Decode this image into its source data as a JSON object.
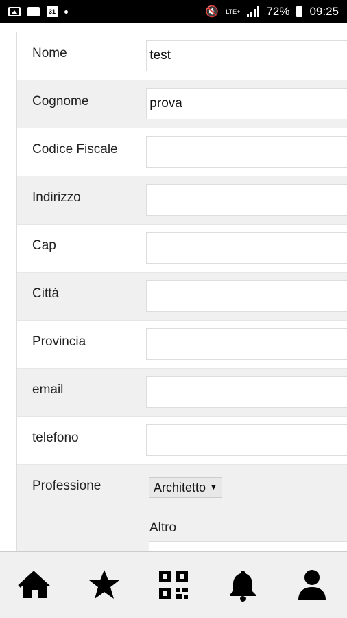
{
  "status_bar": {
    "calendar_day": "31",
    "network": "LTE+",
    "battery": "72%",
    "time": "09:25",
    "icons": [
      "picture-icon",
      "message-icon",
      "calendar-icon",
      "dot-icon",
      "mute-icon",
      "lte-icon",
      "signal-icon",
      "battery-icon"
    ]
  },
  "form": {
    "fields": [
      {
        "label": "Nome",
        "value": "test"
      },
      {
        "label": "Cognome",
        "value": "prova"
      },
      {
        "label": "Codice Fiscale",
        "value": ""
      },
      {
        "label": "Indirizzo",
        "value": ""
      },
      {
        "label": "Cap",
        "value": ""
      },
      {
        "label": "Città",
        "value": ""
      },
      {
        "label": "Provincia",
        "value": ""
      },
      {
        "label": "email",
        "value": ""
      },
      {
        "label": "telefono",
        "value": ""
      }
    ],
    "profession": {
      "label": "Professione",
      "selected": "Architetto",
      "other_label": "Altro"
    }
  },
  "bottom_nav": {
    "items": [
      "home-icon",
      "star-icon",
      "qr-code-icon",
      "bell-icon",
      "user-icon"
    ],
    "background": "#f0f0f0"
  }
}
